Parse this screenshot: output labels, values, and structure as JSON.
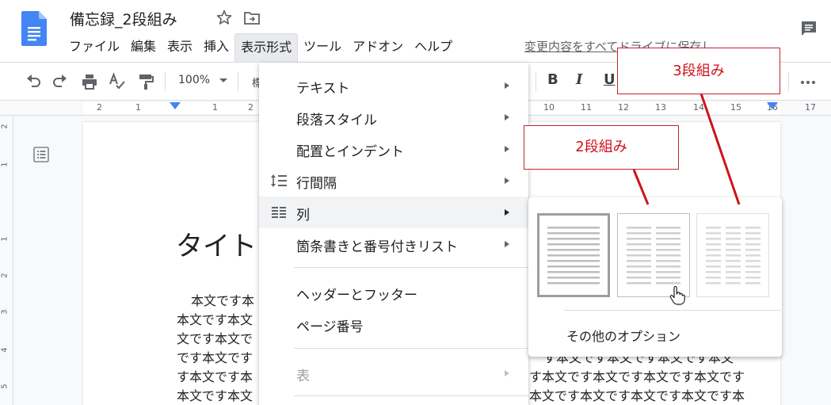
{
  "header": {
    "doc_title": "備忘録_2段組み",
    "menus": [
      "ファイル",
      "編集",
      "表示",
      "挿入",
      "表示形式",
      "ツール",
      "アドオン",
      "ヘルプ"
    ],
    "active_menu_index": 4,
    "save_status": "変更内容をすべてドライブに保存し"
  },
  "toolbar": {
    "zoom": "100%",
    "style_peek": "標",
    "bold": "B",
    "italic": "I",
    "underline": "U"
  },
  "ruler": {
    "h_numbers": [
      "2",
      "1",
      "1",
      "2",
      "10",
      "11",
      "12",
      "13",
      "14",
      "15",
      "16",
      "17"
    ],
    "v_numbers": [
      "2",
      "1",
      "1",
      "2",
      "3",
      "4",
      "5"
    ]
  },
  "document": {
    "title": "タイトル",
    "left_lines": [
      "本文です本",
      "本文です本文",
      "文です本文で",
      "です本文です",
      "す本文です本",
      "本文です本文"
    ],
    "right_lines": [
      "す本文です本文です本文です本文",
      "す本文です本文です本文です本文です",
      "本文です本文です本文です本文です本"
    ]
  },
  "format_menu": {
    "items": [
      {
        "label": "テキスト",
        "icon": "",
        "submenu": true
      },
      {
        "label": "段落スタイル",
        "icon": "",
        "submenu": true
      },
      {
        "label": "配置とインデント",
        "icon": "",
        "submenu": true
      },
      {
        "label": "行間隔",
        "icon": "line-spacing-icon",
        "submenu": true
      },
      {
        "label": "列",
        "icon": "columns-icon",
        "submenu": true
      },
      {
        "label": "箇条書きと番号付きリスト",
        "icon": "",
        "submenu": true
      },
      {
        "label": "ヘッダーとフッター",
        "icon": "",
        "submenu": false
      },
      {
        "label": "ページ番号",
        "icon": "",
        "submenu": false
      },
      {
        "label": "表",
        "icon": "",
        "submenu": true
      }
    ],
    "highlighted_index": 4,
    "disabled_index": 8
  },
  "columns_submenu": {
    "presets": [
      "1-column",
      "2-column",
      "3-column"
    ],
    "selected_index": 0,
    "more_options": "その他のオプション"
  },
  "callouts": {
    "two_col": "2段組み",
    "three_col": "3段組み"
  },
  "colors": {
    "accent": "#4285f4",
    "callout_red": "#d0121c",
    "menu_highlight": "#f1f3f4"
  }
}
